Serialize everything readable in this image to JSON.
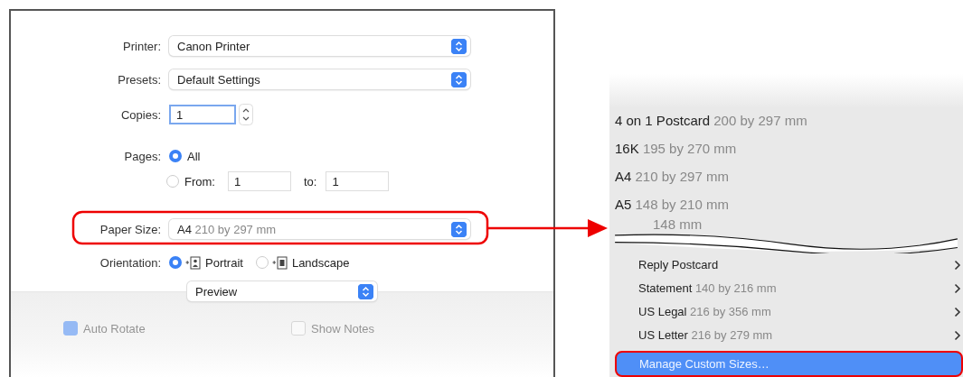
{
  "print_dialog": {
    "printer": {
      "label": "Printer:",
      "value": "Canon Printer"
    },
    "presets": {
      "label": "Presets:",
      "value": "Default Settings"
    },
    "copies": {
      "label": "Copies:",
      "value": "1"
    },
    "pages": {
      "label": "Pages:",
      "options": [
        {
          "label": "All",
          "selected": true
        },
        {
          "label": "From:",
          "selected": false
        }
      ],
      "from": "1",
      "to_label": "to:",
      "to": "1"
    },
    "paper_size": {
      "label": "Paper Size:",
      "name": "A4",
      "dimensions": "210 by 297 mm",
      "highlighted": true
    },
    "orientation": {
      "label": "Orientation:",
      "options": [
        {
          "label": "Portrait",
          "kind": "portrait",
          "selected": true
        },
        {
          "label": "Landscape",
          "kind": "landscape",
          "selected": false
        }
      ]
    },
    "section_menu": "Preview",
    "options": [
      {
        "label": "Auto Rotate",
        "checked": true,
        "disabled": true
      },
      {
        "label": "Show Notes",
        "checked": false,
        "disabled": true
      }
    ]
  },
  "paper_size_menu": {
    "items_top": [
      {
        "name": "4 on 1 Postcard",
        "dimensions": "200 by 297 mm"
      },
      {
        "name": "16K",
        "dimensions": "195 by 270 mm"
      },
      {
        "name": "A4",
        "dimensions": "210 by 297 mm"
      },
      {
        "name": "A5",
        "dimensions": "148 by 210 mm"
      }
    ],
    "cut_text": "148 mm",
    "items_bottom": [
      {
        "name": "Reply Postcard",
        "submenu": true
      },
      {
        "name": "Statement",
        "dimensions": "140 by 216 mm",
        "submenu": true
      },
      {
        "name": "US Legal",
        "dimensions": "216 by 356 mm",
        "submenu": true
      },
      {
        "name": "US Letter",
        "dimensions": "216 by 279 mm",
        "submenu": true
      }
    ],
    "action": {
      "label": "Manage Custom Sizes…",
      "selected": true,
      "highlighted": true
    }
  }
}
